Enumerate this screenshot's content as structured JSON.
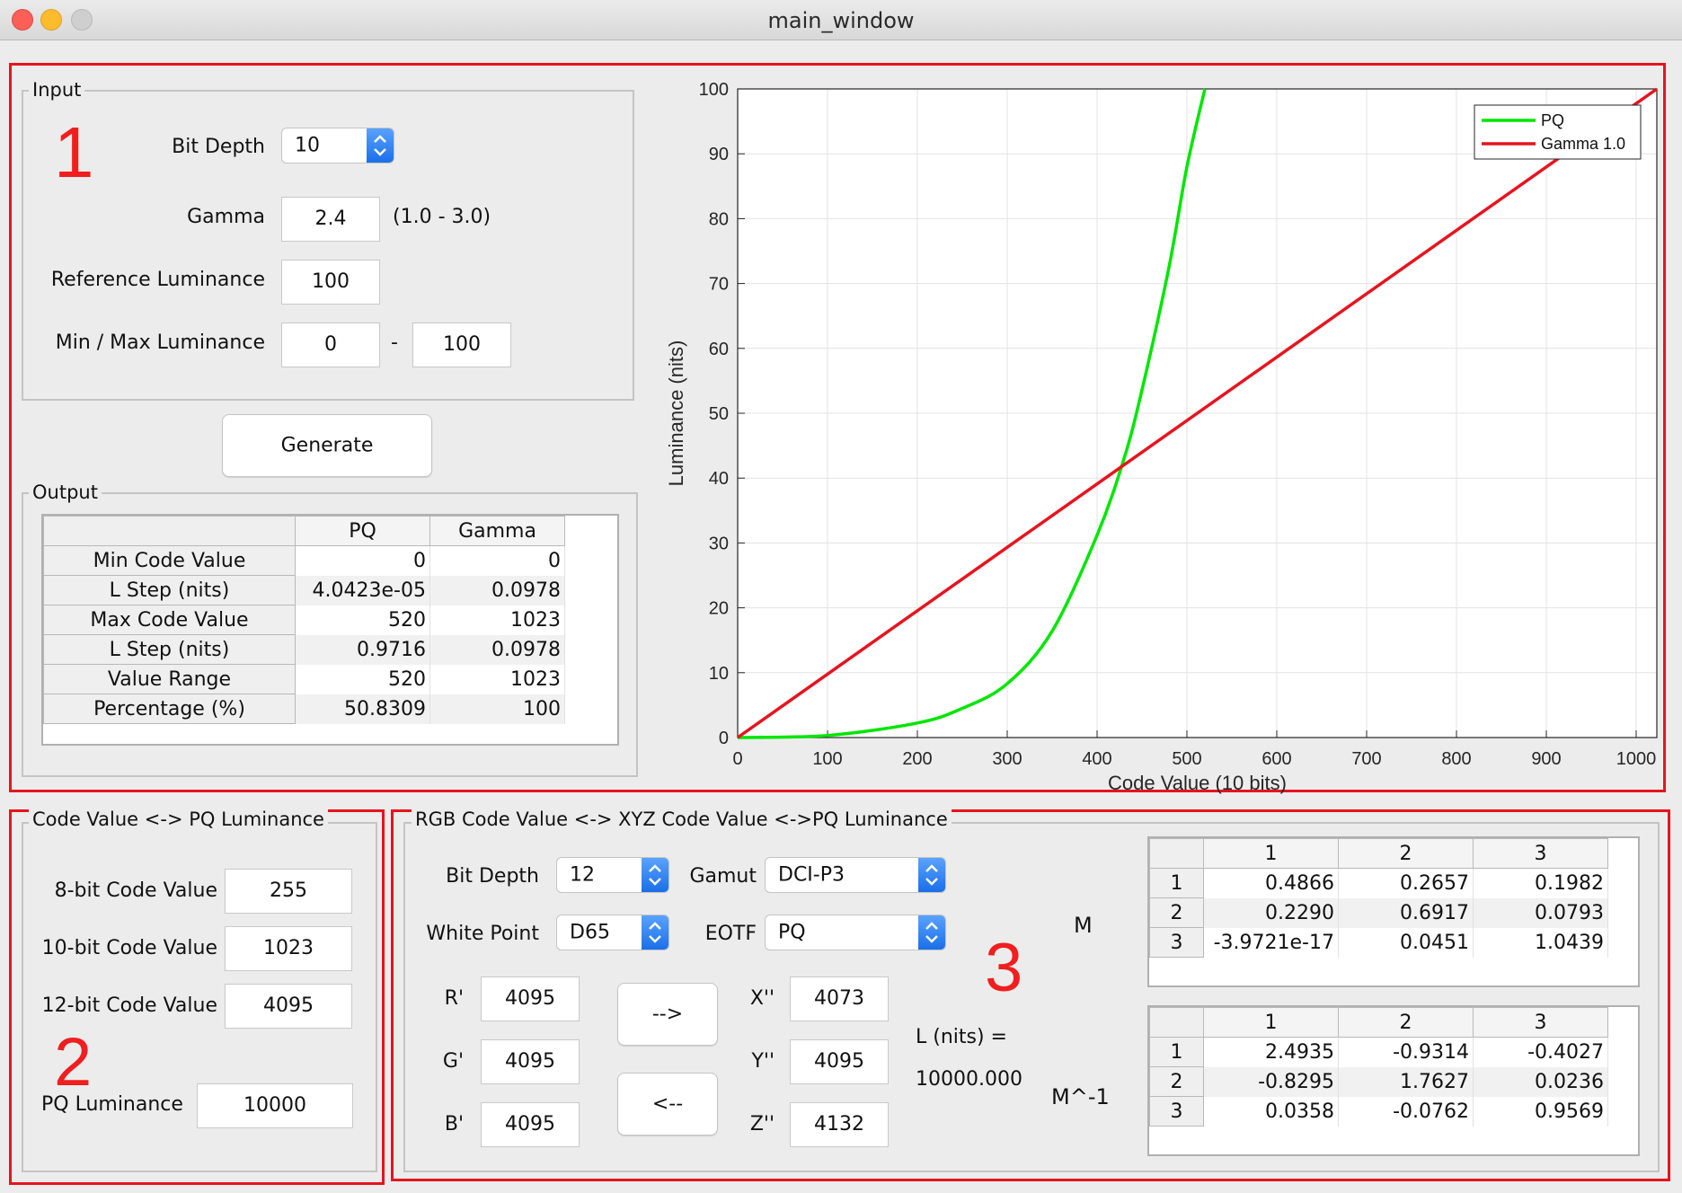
{
  "window": {
    "title": "main_window"
  },
  "annotations": {
    "n1": "1",
    "n2": "2",
    "n3": "3"
  },
  "input": {
    "legend": "Input",
    "bit_depth_label": "Bit Depth",
    "bit_depth": "10",
    "gamma_label": "Gamma",
    "gamma": "2.4",
    "gamma_range": "(1.0 - 3.0)",
    "ref_lum_label": "Reference Luminance",
    "ref_lum": "100",
    "minmax_label": "Min / Max Luminance",
    "min_lum": "0",
    "dash": "-",
    "max_lum": "100"
  },
  "generate_label": "Generate",
  "output": {
    "legend": "Output",
    "columns": [
      "PQ",
      "Gamma"
    ],
    "rows": [
      {
        "label": "Min Code Value",
        "pq": "0",
        "gamma": "0"
      },
      {
        "label": "L Step (nits)",
        "pq": "4.0423e-05",
        "gamma": "0.0978"
      },
      {
        "label": "Max Code Value",
        "pq": "520",
        "gamma": "1023"
      },
      {
        "label": "L Step (nits)",
        "pq": "0.9716",
        "gamma": "0.0978"
      },
      {
        "label": "Value Range",
        "pq": "520",
        "gamma": "1023"
      },
      {
        "label": "Percentage (%)",
        "pq": "50.8309",
        "gamma": "100"
      }
    ]
  },
  "chart_data": {
    "type": "line",
    "xlabel": "Code Value (10 bits)",
    "ylabel": "Luminance (nits)",
    "xlim": [
      0,
      1023
    ],
    "ylim": [
      0,
      100
    ],
    "xticks": [
      0,
      100,
      200,
      300,
      400,
      500,
      600,
      700,
      800,
      900,
      1000
    ],
    "yticks": [
      0,
      10,
      20,
      30,
      40,
      50,
      60,
      70,
      80,
      90,
      100
    ],
    "grid": true,
    "legend_position": "top-right",
    "series": [
      {
        "name": "PQ",
        "color": "#00e600",
        "x": [
          0,
          100,
          200,
          250,
          300,
          350,
          400,
          430,
          450,
          480,
          500,
          520
        ],
        "y": [
          0,
          0.32,
          2.24,
          4.5,
          8.3,
          16.4,
          31.2,
          43,
          53.6,
          72.5,
          88,
          100
        ]
      },
      {
        "name": "Gamma 1.0",
        "color": "#e6141e",
        "x": [
          0,
          1023
        ],
        "y": [
          0,
          100
        ]
      }
    ]
  },
  "code_pq": {
    "legend": "Code Value <-> PQ Luminance",
    "cv8_label": "8-bit Code Value",
    "cv8": "255",
    "cv10_label": "10-bit Code Value",
    "cv10": "1023",
    "cv12_label": "12-bit Code Value",
    "cv12": "4095",
    "pq_label": "PQ Luminance",
    "pq": "10000"
  },
  "rgb_xyz": {
    "legend": "RGB Code Value <-> XYZ Code Value <->PQ Luminance",
    "bit_depth_label": "Bit Depth",
    "bit_depth": "12",
    "gamut_label": "Gamut",
    "gamut": "DCI-P3",
    "white_point_label": "White Point",
    "white_point": "D65",
    "eotf_label": "EOTF",
    "eotf": "PQ",
    "r_label": "R'",
    "r": "4095",
    "g_label": "G'",
    "g": "4095",
    "b_label": "B'",
    "b": "4095",
    "x_label": "X''",
    "x": "4073",
    "y_label": "Y''",
    "y": "4095",
    "z_label": "Z''",
    "z": "4132",
    "forward_label": "-->",
    "back_label": "<--",
    "lnits_label": "L (nits) =",
    "lnits_value": "10000.000",
    "m_label": "M",
    "minv_label": "M^-1",
    "matrix_cols": [
      "1",
      "2",
      "3"
    ],
    "m": [
      [
        "0.4866",
        "0.2657",
        "0.1982"
      ],
      [
        "0.2290",
        "0.6917",
        "0.0793"
      ],
      [
        "-3.9721e-17",
        "0.0451",
        "1.0439"
      ]
    ],
    "minv": [
      [
        "2.4935",
        "-0.9314",
        "-0.4027"
      ],
      [
        "-0.8295",
        "1.7627",
        "0.0236"
      ],
      [
        "0.0358",
        "-0.0762",
        "0.9569"
      ]
    ]
  }
}
